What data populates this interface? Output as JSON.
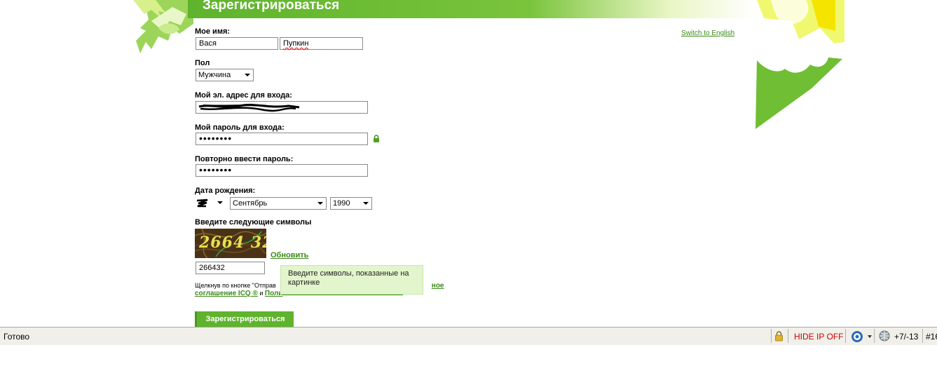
{
  "header": {
    "title": "Зарегистрироваться"
  },
  "lang_switch": "Switch to English",
  "form": {
    "name": {
      "label": "Мое имя:",
      "first": "Вася",
      "last": "Пупкин"
    },
    "gender": {
      "label": "Пол",
      "value": "Мужчина"
    },
    "email": {
      "label": "Мой эл. адрес для входа:"
    },
    "password": {
      "label": "Мой пароль для входа:",
      "value": "••••••••"
    },
    "password_repeat": {
      "label": "Повторно ввести пароль:",
      "value": "••••••••"
    },
    "birthdate": {
      "label": "Дата рождения:",
      "month": "Сентябрь",
      "year": "1990"
    },
    "captcha": {
      "label": "Введите следующие символы",
      "image_text": "2664 32",
      "refresh": "Обновить",
      "value": "266432"
    },
    "tooltip": "Введите символы, показанные на картинке",
    "terms": {
      "prefix": "Щелкнув по кнопке \"Отправ",
      "link1_tail": "ное",
      "link1_line2": "соглашение ICQ ®",
      "and": " и ",
      "link2": "Поли"
    },
    "submit": "Зарегистрироваться"
  },
  "statusbar": {
    "status": "Готово",
    "hideip": "HIDE IP OFF",
    "temp": "+7/-13",
    "extra": "#16"
  },
  "colors": {
    "brand_green": "#5fb32d",
    "link_green": "#3a8a17",
    "tooltip_bg": "#e2f5cc",
    "hideip_red": "#cc0000"
  }
}
